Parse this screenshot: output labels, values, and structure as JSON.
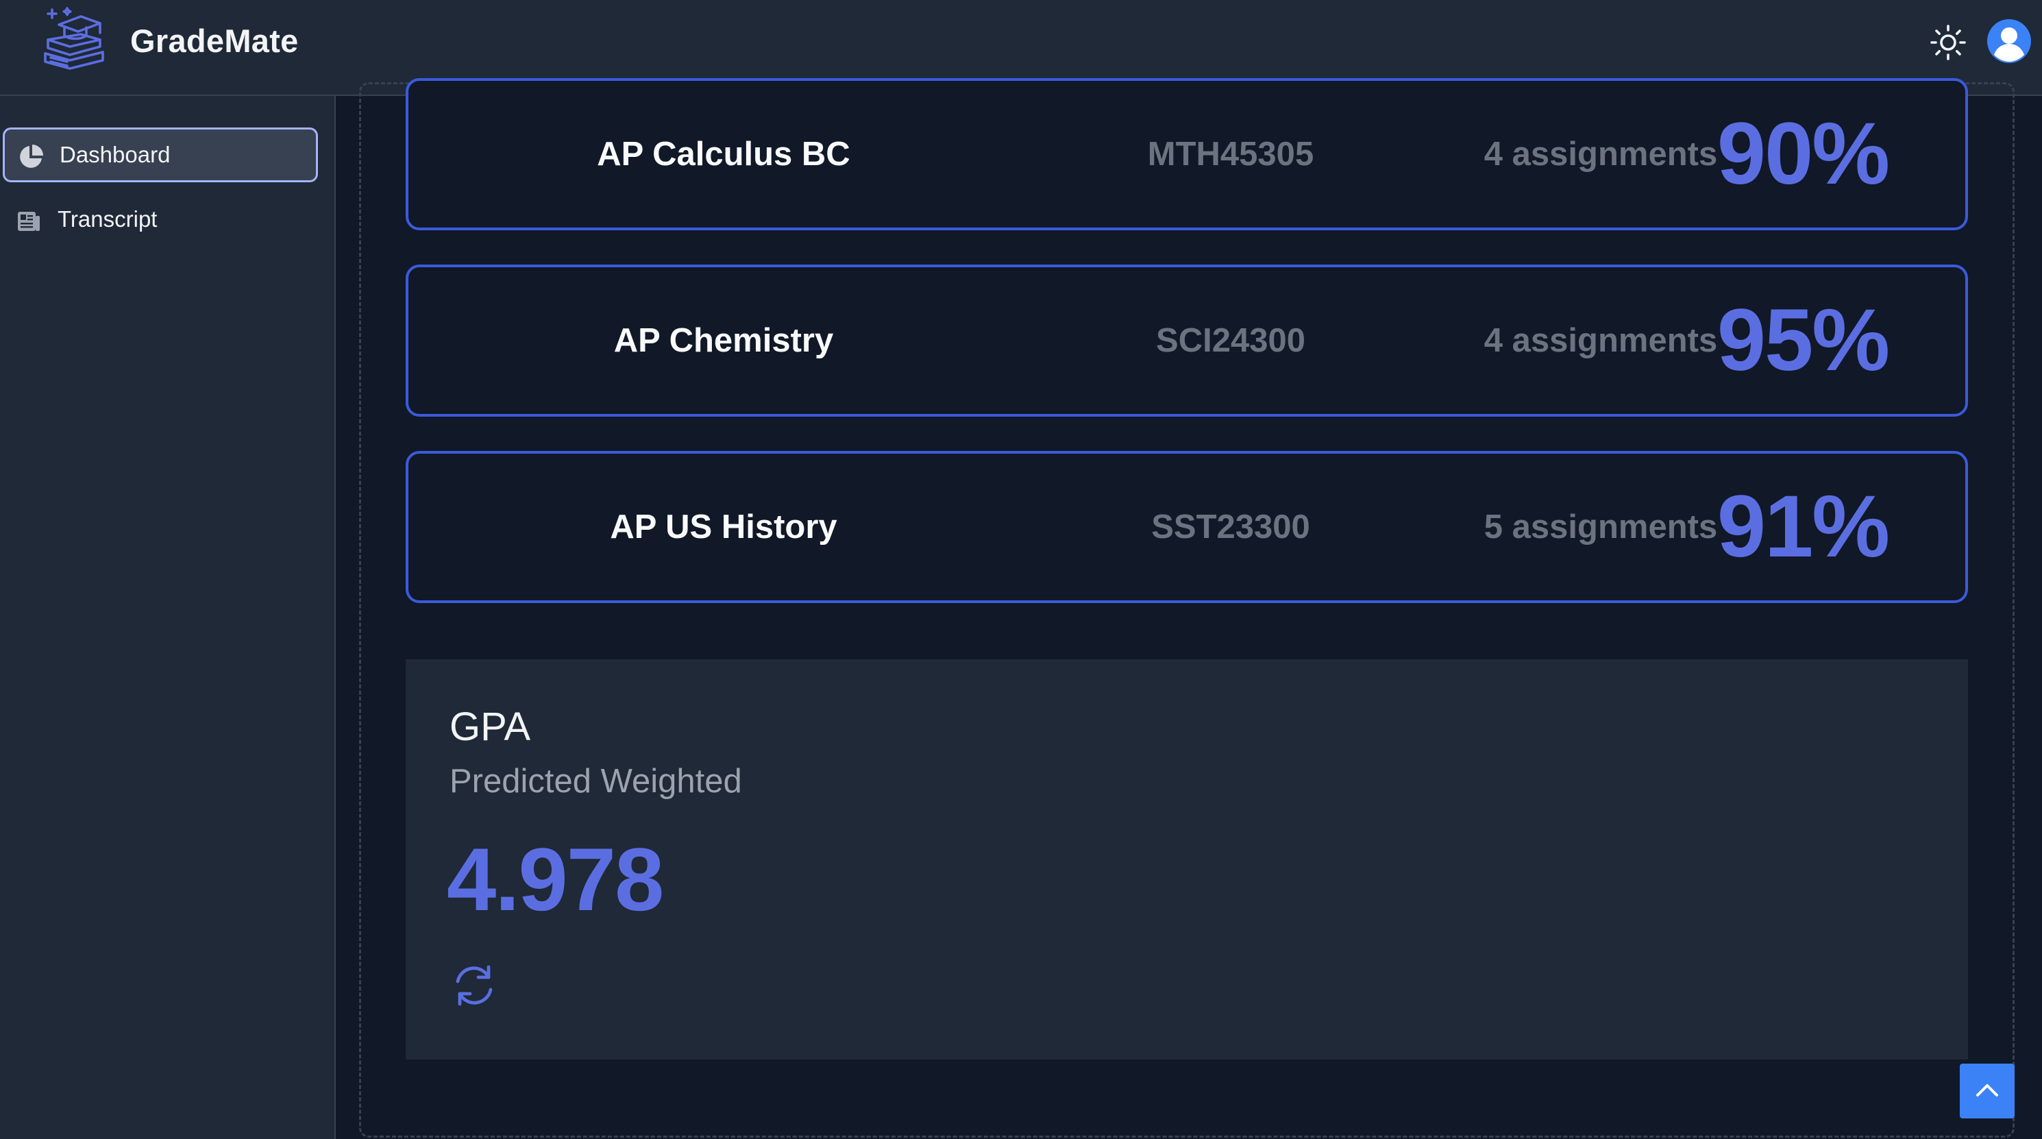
{
  "app": {
    "name": "GradeMate"
  },
  "header": {
    "theme_toggle_icon": "sun-icon",
    "avatar_icon": "user-avatar-icon"
  },
  "sidebar": {
    "items": [
      {
        "label": "Dashboard",
        "icon": "pie-chart-icon",
        "active": true
      },
      {
        "label": "Transcript",
        "icon": "newspaper-icon",
        "active": false
      }
    ]
  },
  "courses": [
    {
      "name": "AP Calculus BC",
      "code": "MTH45305",
      "assignments": "4 assignments",
      "grade": "90%"
    },
    {
      "name": "AP Chemistry",
      "code": "SCI24300",
      "assignments": "4 assignments",
      "grade": "95%"
    },
    {
      "name": "AP US History",
      "code": "SST23300",
      "assignments": "5 assignments",
      "grade": "91%"
    }
  ],
  "gpa": {
    "title": "GPA",
    "subtitle": "Predicted Weighted",
    "value": "4.978",
    "refresh_icon": "refresh-icon"
  },
  "colors": {
    "accent": "#5b6ee1",
    "card_border": "#3b5bdb",
    "background": "#111827",
    "panel": "#1f2937"
  }
}
